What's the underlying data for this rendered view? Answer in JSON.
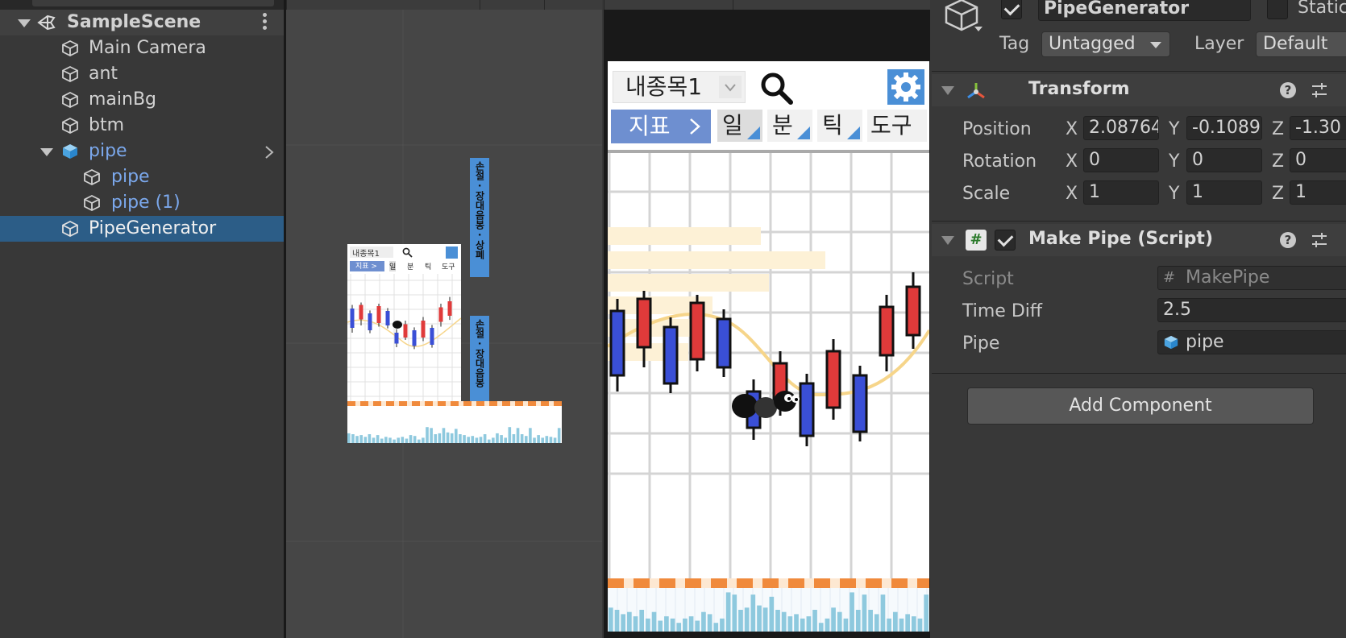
{
  "hierarchy": {
    "scene_name": "SampleScene",
    "items": [
      {
        "label": "Main Camera"
      },
      {
        "label": "ant"
      },
      {
        "label": "mainBg"
      },
      {
        "label": "btm"
      },
      {
        "label": "pipe"
      },
      {
        "label": "pipe"
      },
      {
        "label": "pipe (1)"
      },
      {
        "label": "PipeGenerator"
      }
    ]
  },
  "scene_view": {
    "mini_stock_name": "내종목1",
    "mini_tabs": [
      "지표 >",
      "일",
      "분",
      "틱",
      "도구"
    ],
    "banner_top": "손절 · 장대음봉 · 상폐",
    "banner_bottom": "손절 · 장대음봉"
  },
  "game_view": {
    "stock_name": "내종목1",
    "indicator_button": "지표",
    "tabs": [
      "일",
      "분",
      "틱",
      "도구"
    ],
    "candles": [
      {
        "color": "blue",
        "open": 310,
        "close": 390,
        "high": 295,
        "low": 410
      },
      {
        "color": "red",
        "open": 355,
        "close": 295,
        "high": 285,
        "low": 380
      },
      {
        "color": "blue",
        "open": 330,
        "close": 400,
        "high": 318,
        "low": 412
      },
      {
        "color": "red",
        "open": 370,
        "close": 300,
        "high": 290,
        "low": 385
      },
      {
        "color": "blue",
        "open": 320,
        "close": 380,
        "high": 308,
        "low": 392
      },
      {
        "color": "blue",
        "open": 410,
        "close": 455,
        "high": 395,
        "low": 470
      },
      {
        "color": "red",
        "open": 430,
        "close": 375,
        "high": 360,
        "low": 440
      },
      {
        "color": "blue",
        "open": 400,
        "close": 465,
        "high": 388,
        "low": 478
      },
      {
        "color": "red",
        "open": 430,
        "close": 360,
        "high": 345,
        "low": 445
      },
      {
        "color": "blue",
        "open": 390,
        "close": 460,
        "high": 378,
        "low": 472
      },
      {
        "color": "red",
        "open": 365,
        "close": 305,
        "high": 290,
        "low": 385
      },
      {
        "color": "red",
        "open": 340,
        "close": 280,
        "high": 262,
        "low": 357
      }
    ],
    "volume_bars": [
      0.55,
      0.5,
      0.4,
      0.45,
      0.35,
      0.5,
      0.3,
      0.45,
      0.25,
      0.35,
      0.3,
      0.2,
      0.3,
      0.35,
      0.25,
      0.45,
      0.4,
      0.2,
      0.3,
      0.9,
      0.85,
      0.5,
      0.55,
      0.85,
      0.6,
      0.55,
      0.8,
      0.5,
      0.45,
      0.35,
      0.4,
      0.3,
      0.35,
      0.5,
      0.2,
      0.3,
      0.55,
      0.45,
      0.3,
      0.9,
      0.5,
      0.85,
      0.5,
      0.4,
      0.85,
      0.3,
      0.45,
      0.3,
      0.4,
      0.35,
      0.3,
      0.85
    ]
  },
  "inspector": {
    "object_name": "PipeGenerator",
    "static_label": "Static",
    "tag_label": "Tag",
    "tag_value": "Untagged",
    "layer_label": "Layer",
    "layer_value": "Default",
    "transform": {
      "title": "Transform",
      "rows": [
        {
          "label": "Position",
          "x": "2.08764",
          "y": "-0.1089",
          "z": "-1.30"
        },
        {
          "label": "Rotation",
          "x": "0",
          "y": "0",
          "z": "0"
        },
        {
          "label": "Scale",
          "x": "1",
          "y": "1",
          "z": "1"
        }
      ],
      "axis_x": "X",
      "axis_y": "Y",
      "axis_z": "Z"
    },
    "script_component": {
      "title": "Make Pipe (Script)",
      "script_label": "Script",
      "script_value": "MakePipe",
      "time_diff_label": "Time Diff",
      "time_diff_value": "2.5",
      "pipe_label": "Pipe",
      "pipe_value": "pipe"
    },
    "add_component": "Add Component"
  }
}
